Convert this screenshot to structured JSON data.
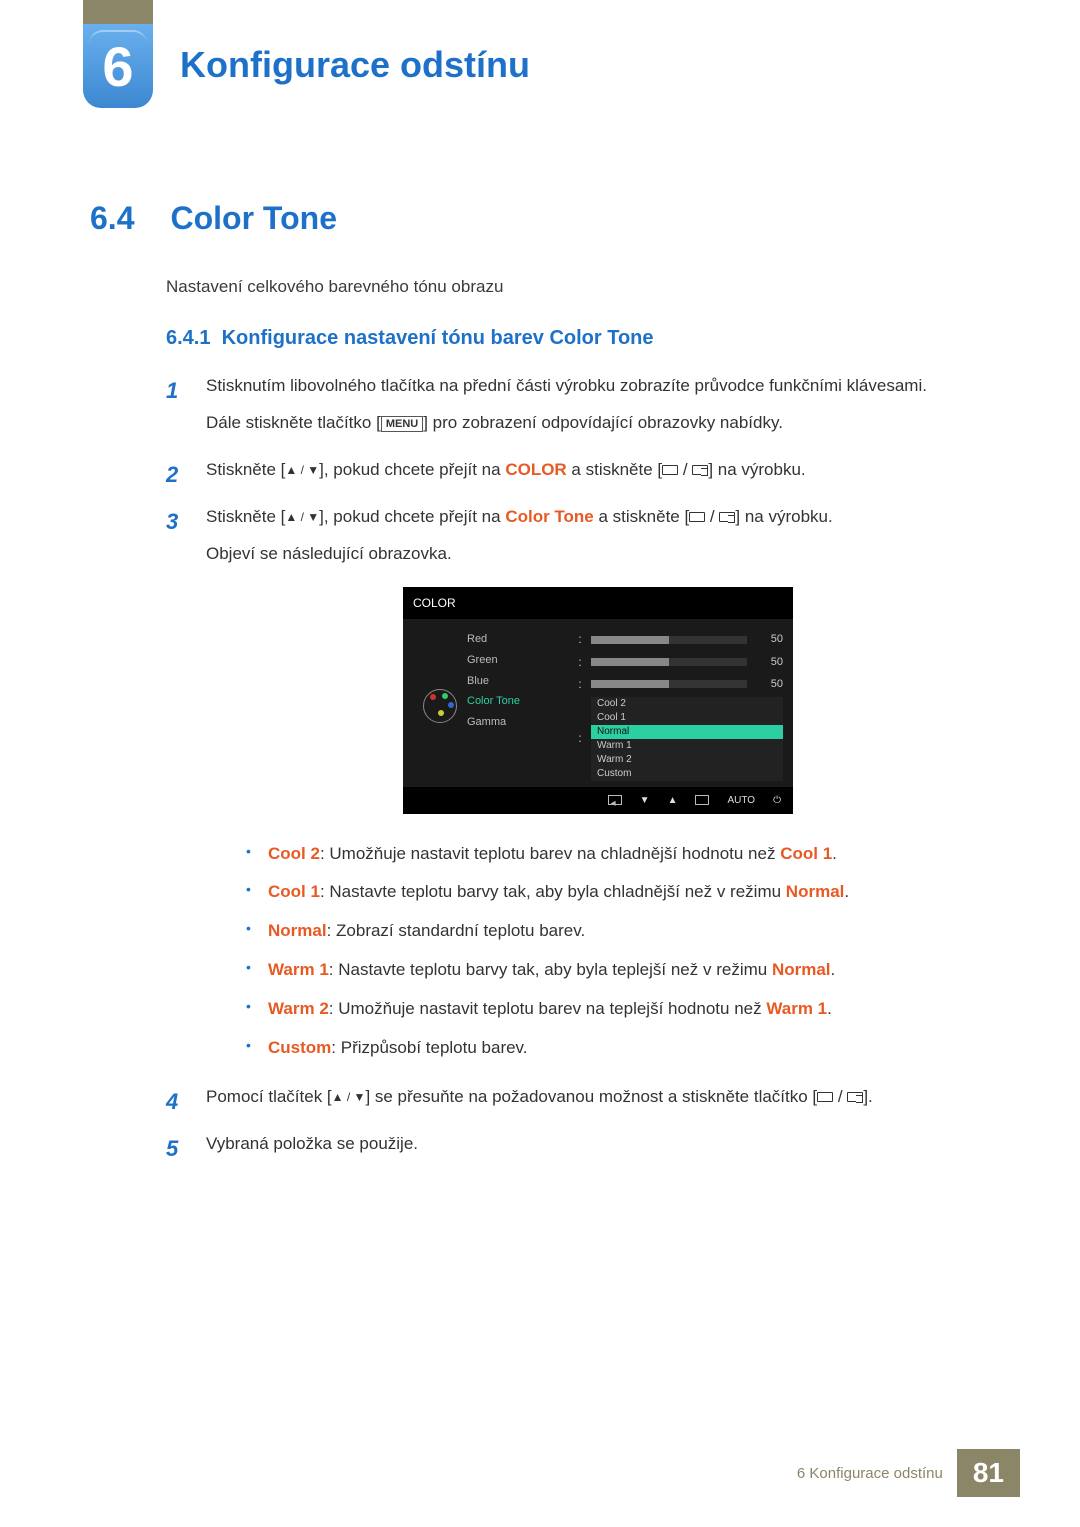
{
  "chapter": {
    "number": "6",
    "title": "Konfigurace odstínu"
  },
  "section": {
    "number": "6.4",
    "title": "Color Tone",
    "intro": "Nastavení celkového barevného tónu obrazu"
  },
  "subsection": {
    "number": "6.4.1",
    "title": "Konfigurace nastavení tónu barev Color Tone"
  },
  "steps": {
    "s1a": "Stisknutím libovolného tlačítka na přední části výrobku zobrazíte průvodce funkčními klávesami.",
    "s1b_pre": "Dále stiskněte tlačítko [",
    "s1b_btn": "MENU",
    "s1b_post": "] pro zobrazení odpovídající obrazovky nabídky.",
    "s2_pre": "Stiskněte [",
    "s2_mid": "], pokud chcete přejít na ",
    "s2_kw": "COLOR",
    "s2_post1": " a stiskněte [",
    "s2_post2": "] na výrobku.",
    "s3_pre": "Stiskněte [",
    "s3_mid": "], pokud chcete přejít na ",
    "s3_kw": "Color Tone",
    "s3_post1": " a stiskněte [",
    "s3_post2": "] na výrobku.",
    "s3_tail": "Objeví se následující obrazovka.",
    "s4_pre": "Pomocí tlačítek [",
    "s4_mid": "] se přesuňte na požadovanou možnost a stiskněte tlačítko [",
    "s4_post": "].",
    "s5": "Vybraná položka se použije."
  },
  "osd": {
    "title": "COLOR",
    "items": {
      "red": "Red",
      "green": "Green",
      "blue": "Blue",
      "colortone": "Color Tone",
      "gamma": "Gamma"
    },
    "values": {
      "red": "50",
      "green": "50",
      "blue": "50"
    },
    "drop": {
      "cool2": "Cool 2",
      "cool1": "Cool 1",
      "normal": "Normal",
      "warm1": "Warm 1",
      "warm2": "Warm 2",
      "custom": "Custom"
    },
    "auto": "AUTO"
  },
  "bullets": {
    "b1_k": "Cool 2",
    "b1_t": ": Umožňuje nastavit teplotu barev na chladnější hodnotu než ",
    "b1_k2": "Cool 1",
    "b1_end": ".",
    "b2_k": "Cool 1",
    "b2_t": ": Nastavte teplotu barvy tak, aby byla chladnější než v režimu ",
    "b2_k2": "Normal",
    "b2_end": ".",
    "b3_k": "Normal",
    "b3_t": ": Zobrazí standardní teplotu barev.",
    "b4_k": "Warm 1",
    "b4_t": ": Nastavte teplotu barvy tak, aby byla teplejší než v režimu ",
    "b4_k2": "Normal",
    "b4_end": ".",
    "b5_k": "Warm 2",
    "b5_t": ": Umožňuje nastavit teplotu barev na teplejší hodnotu než ",
    "b5_k2": "Warm 1",
    "b5_end": ".",
    "b6_k": "Custom",
    "b6_t": ": Přizpůsobí teplotu barev."
  },
  "footer": {
    "text": "6 Konfigurace odstínu",
    "page": "81"
  }
}
